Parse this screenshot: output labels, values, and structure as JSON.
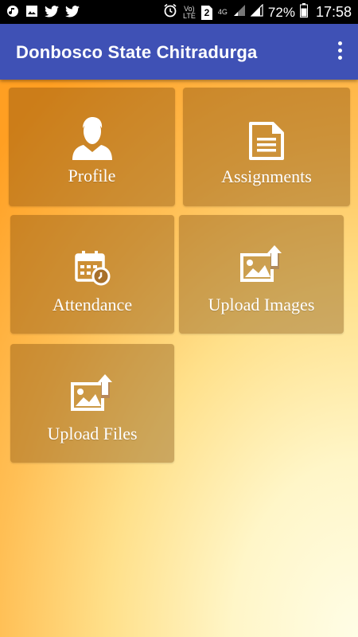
{
  "status_bar": {
    "battery_percent": "72%",
    "time": "17:58",
    "volte_label": "Vo) LTE",
    "network_label": "4G",
    "sim_badge": "2",
    "left_icons": [
      "music-app-icon",
      "image-notification-icon",
      "twitter-icon",
      "twitter-icon"
    ],
    "right_icons": [
      "alarm-icon",
      "volte-icon",
      "sim-icon",
      "signal-icon",
      "signal-icon",
      "battery-icon"
    ]
  },
  "app_bar": {
    "title": "Donbosco State Chitradurga",
    "menu_icon": "more-vert-icon",
    "color": "#3f51b5"
  },
  "tiles": [
    {
      "label": "Profile",
      "icon": "person-icon"
    },
    {
      "label": "Assignments",
      "icon": "document-icon"
    },
    {
      "label": "Attendance",
      "icon": "calendar-clock-icon"
    },
    {
      "label": "Upload Images",
      "icon": "image-upload-icon"
    },
    {
      "label": "Upload Files",
      "icon": "image-upload-icon"
    }
  ],
  "colors": {
    "accent": "#3f51b5",
    "background_top": "#ff9f22",
    "background_bottom": "#fffde6"
  }
}
